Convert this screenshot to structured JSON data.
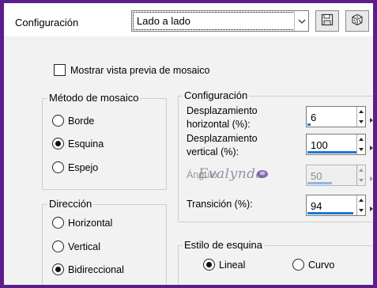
{
  "header": {
    "title": "Configuración",
    "preset_value": "Lado a lado",
    "save_icon": "floppy-disk-icon",
    "randomize_icon": "dice-icon"
  },
  "preview_checkbox": {
    "label": "Mostrar vista previa de mosaico",
    "checked": false
  },
  "tile_method": {
    "title": "Método de mosaico",
    "options": [
      {
        "label": "Borde",
        "checked": false
      },
      {
        "label": "Esquina",
        "checked": true
      },
      {
        "label": "Espejo",
        "checked": false
      }
    ]
  },
  "direction": {
    "title": "Dirección",
    "options": [
      {
        "label": "Horizontal",
        "checked": false
      },
      {
        "label": "Vertical",
        "checked": false
      },
      {
        "label": "Bidireccional",
        "checked": true
      }
    ]
  },
  "settings": {
    "title": "Configuración",
    "h_offset": {
      "label_line1": "Desplazamiento",
      "label_line2": "horizontal (%):",
      "value": "6",
      "fill": 0.06
    },
    "v_offset": {
      "label_line1": "Desplazamiento",
      "label_line2": "vertical (%):",
      "value": "100",
      "fill": 1.0
    },
    "angle": {
      "label": "Ángulo:",
      "value": "50",
      "fill": 0.5,
      "disabled": true
    },
    "transition": {
      "label": "Transición (%):",
      "value": "94",
      "fill": 0.94
    }
  },
  "corner_style": {
    "title": "Estilo de esquina",
    "options": [
      {
        "label": "Lineal",
        "checked": true
      },
      {
        "label": "Curvo",
        "checked": false
      }
    ]
  },
  "watermark": {
    "text": "Evalynda"
  },
  "colors": {
    "frame": "#5b1e8e",
    "accent": "#1e78d7",
    "panel": "#f2f2f2"
  }
}
